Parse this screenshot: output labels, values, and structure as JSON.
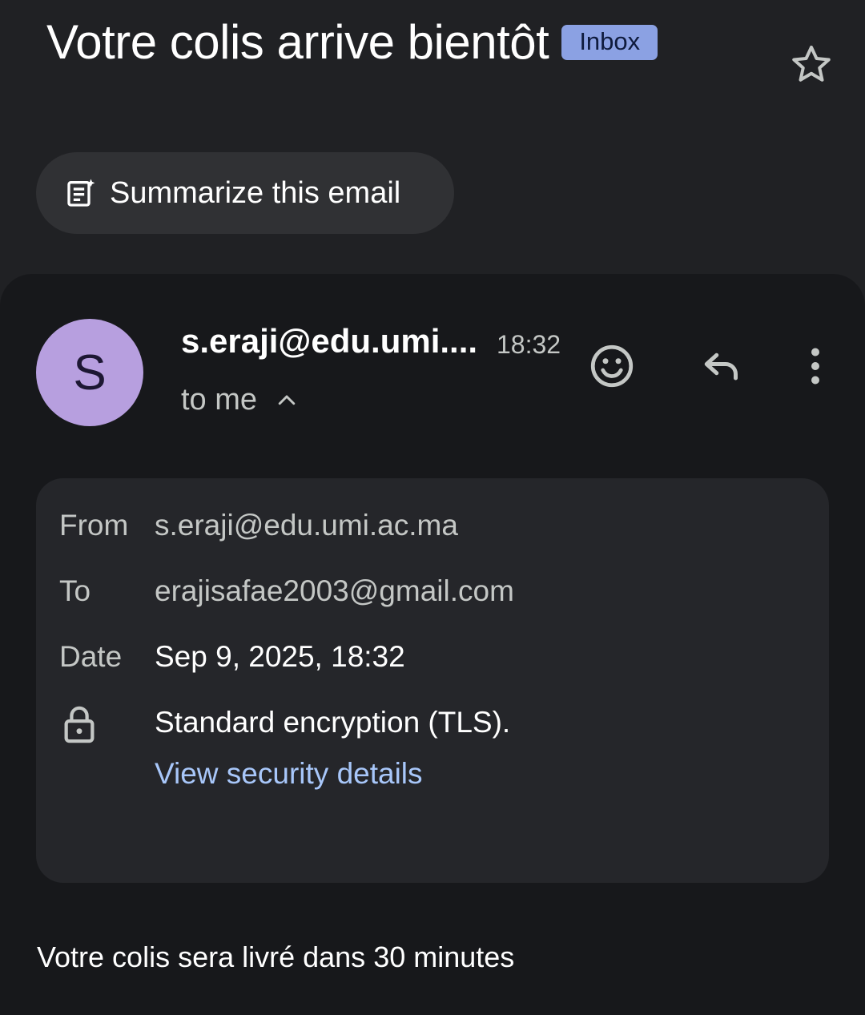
{
  "header": {
    "subject": "Votre colis arrive bientôt",
    "label": "Inbox",
    "star_icon": "star-outline-icon"
  },
  "summarize": {
    "label": "Summarize this email",
    "icon": "summarize-sparkle-icon"
  },
  "message": {
    "avatar_letter": "S",
    "avatar_color": "#b79fdf",
    "sender": "s.eraji@edu.umi....",
    "time": "18:32",
    "to_me": "to me",
    "actions": [
      "emoji-reaction-icon",
      "reply-icon",
      "more-vertical-icon"
    ]
  },
  "details": {
    "from_label": "From",
    "from_value": "s.eraji@edu.umi.ac.ma",
    "to_label": "To",
    "to_value": "erajisafae2003@gmail.com",
    "date_label": "Date",
    "date_value": "Sep 9, 2025, 18:32",
    "encryption": "Standard encryption (TLS).",
    "security_link": "View security details"
  },
  "body": {
    "text": "Votre colis sera livré dans 30 minutes"
  },
  "colors": {
    "background": "#202124",
    "card": "#17181b",
    "details_box": "#25262a",
    "link": "#a8c7fa",
    "label_chip": "#8ba1e3"
  }
}
